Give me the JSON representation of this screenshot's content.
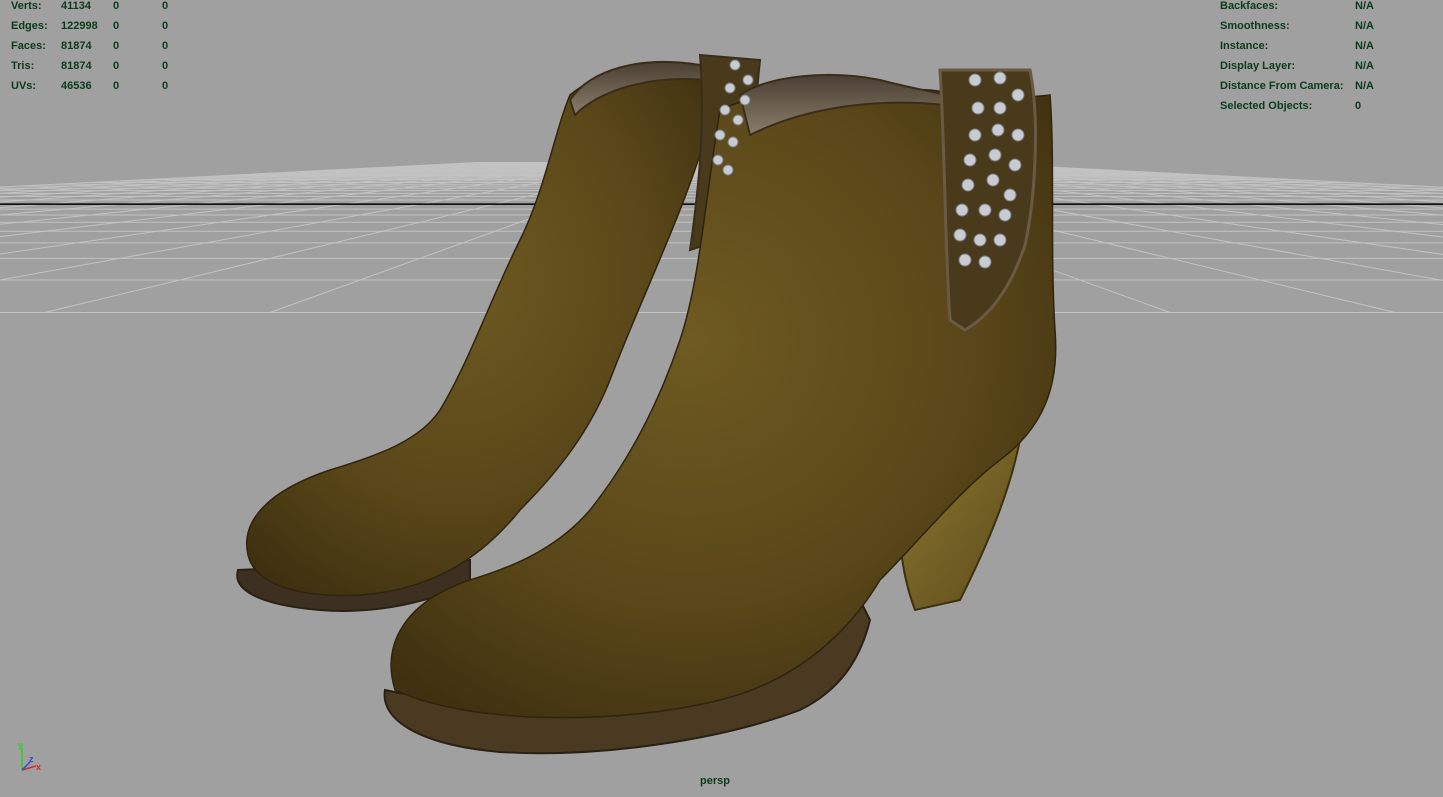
{
  "stats_left": {
    "rows": [
      {
        "label": "Verts:",
        "v1": "41134",
        "v2": "0",
        "v3": "0"
      },
      {
        "label": "Edges:",
        "v1": "122998",
        "v2": "0",
        "v3": "0"
      },
      {
        "label": "Faces:",
        "v1": "81874",
        "v2": "0",
        "v3": "0"
      },
      {
        "label": "Tris:",
        "v1": "81874",
        "v2": "0",
        "v3": "0"
      },
      {
        "label": "UVs:",
        "v1": "46536",
        "v2": "0",
        "v3": "0"
      }
    ]
  },
  "stats_right": {
    "rows": [
      {
        "label": "Backfaces:",
        "value": "N/A"
      },
      {
        "label": "Smoothness:",
        "value": "N/A"
      },
      {
        "label": "Instance:",
        "value": "N/A"
      },
      {
        "label": "Display Layer:",
        "value": "N/A"
      },
      {
        "label": "Distance From Camera:",
        "value": "N/A"
      },
      {
        "label": "Selected Objects:",
        "value": "0"
      }
    ]
  },
  "camera": {
    "name": "persp"
  },
  "axis_gizmo": {
    "x": "x",
    "y": "y",
    "z": "z"
  },
  "colors": {
    "viewport_bg": "#a0a0a0",
    "grid_line": "#c2c2c2",
    "axis_line": "#000000",
    "hud_text": "#0b3b1a",
    "boot_leather": "#5e4a1c",
    "boot_sole": "#4a3a22",
    "stud": "#c8ccd2"
  },
  "icons": {
    "axis": "xyz-axis-gizmo-icon"
  }
}
